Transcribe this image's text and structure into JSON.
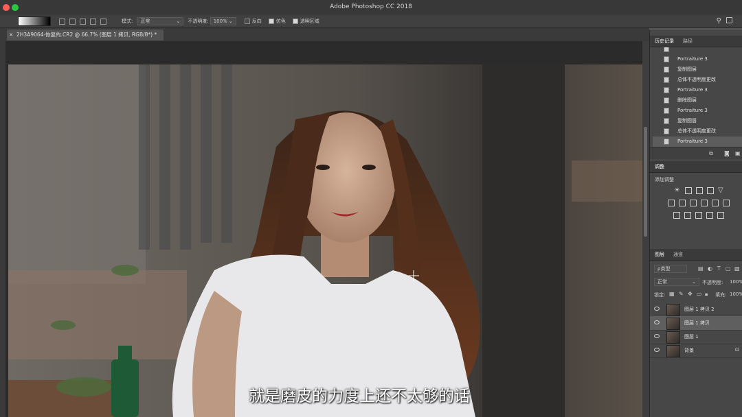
{
  "app": {
    "title": "Adobe Photoshop CC 2018"
  },
  "options_bar": {
    "mode_label": "模式:",
    "mode_value": "正常",
    "opacity_label": "不透明度:",
    "opacity_value": "100%",
    "reverse_label": "反向",
    "dither_label": "仿色",
    "transparency_label": "透明区域",
    "reverse_checked": false,
    "dither_checked": true,
    "transparency_checked": true
  },
  "document_tab": {
    "label": "2H3A9064-恢复的.CR2 @ 66.7% (图层 1 拷贝, RGB/8*) *"
  },
  "subtitle": "就是磨皮的力度上还不太够的话",
  "history_panel": {
    "tabs": [
      "历史记录",
      "路径"
    ],
    "items": [
      "Portraiture 3",
      "复制图层",
      "总体不透明度更改",
      "Portraiture 3",
      "删除图层",
      "Portraiture 3",
      "复制图层",
      "总体不透明度更改",
      "Portraiture 3"
    ],
    "selected_index": 8
  },
  "adjustments_panel": {
    "tab": "调整",
    "subtitle": "添加调整"
  },
  "layers_panel": {
    "tabs": [
      "图层",
      "通道"
    ],
    "filter_label": "ρ类型",
    "blend_mode": "正常",
    "opacity_label": "不透明度:",
    "opacity_value": "100%",
    "lock_label": "锁定:",
    "fill_label": "填充:",
    "fill_value": "100%",
    "layers": [
      "图层 1 拷贝 2",
      "图层 1 拷贝",
      "图层 1",
      "背景"
    ],
    "selected_index": 1
  },
  "colors": {
    "panel_bg": "#474747",
    "titlebar_bg": "#383838",
    "canvas_bg": "#2b2b2b",
    "tl_close": "#ff5f57",
    "tl_min": "#febc2e",
    "tl_max": "#28c840"
  }
}
